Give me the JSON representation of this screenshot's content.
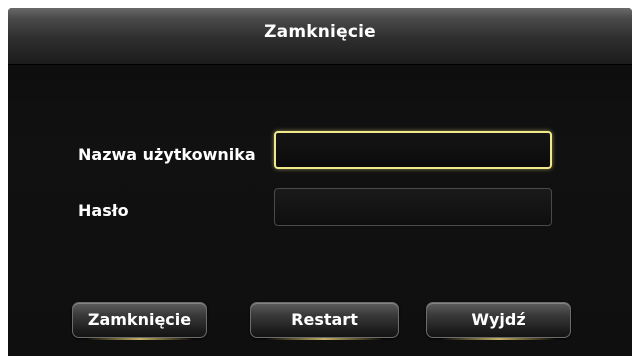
{
  "dialog": {
    "title": "Zamknięcie"
  },
  "form": {
    "username_label": "Nazwa użytkownika",
    "username_value": "",
    "password_label": "Hasło",
    "password_value": ""
  },
  "buttons": {
    "shutdown_label": "Zamknięcie",
    "restart_label": "Restart",
    "exit_label": "Wyjdź"
  },
  "colors": {
    "focus_border": "#f1ea8a",
    "button_accent": "#d8c26a",
    "background": "#0f0f0f"
  }
}
